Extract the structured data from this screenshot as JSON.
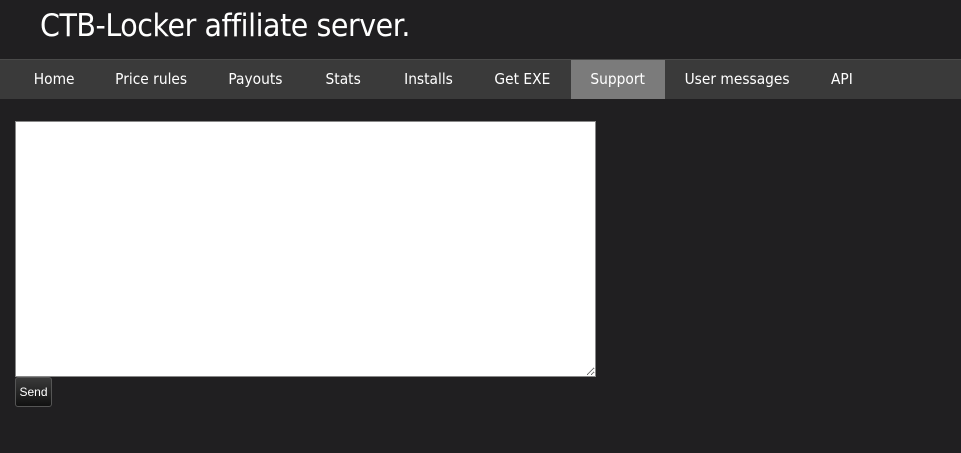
{
  "header": {
    "title": "CTB-Locker affiliate server."
  },
  "nav": {
    "items": [
      {
        "label": "Home"
      },
      {
        "label": "Price rules"
      },
      {
        "label": "Payouts"
      },
      {
        "label": "Stats"
      },
      {
        "label": "Installs"
      },
      {
        "label": "Get EXE"
      },
      {
        "label": "Support",
        "active": true
      },
      {
        "label": "User messages"
      },
      {
        "label": "API"
      }
    ]
  },
  "support": {
    "message_value": "",
    "send_label": "Send"
  },
  "colors": {
    "background": "#201f21",
    "nav_background": "#3a3a3a",
    "nav_active": "#7b7b7b",
    "text": "#ffffff"
  }
}
